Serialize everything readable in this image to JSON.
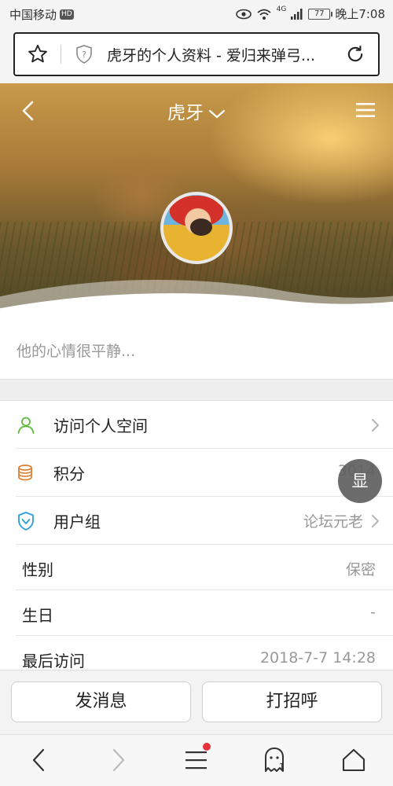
{
  "status_bar": {
    "carrier": "中国移动",
    "hd_badge": "HD",
    "network": "4G",
    "battery": "77",
    "time": "晚上7:08"
  },
  "browser": {
    "url_title": "虎牙的个人资料 - 爱归来弹弓..."
  },
  "profile": {
    "username": "虎牙",
    "mood": "他的心情很平静..."
  },
  "rows": [
    {
      "label": "访问个人空间",
      "value": "",
      "icon": "person-icon",
      "icon_color": "#5cbb3c"
    },
    {
      "label": "积分",
      "value": "3014",
      "icon": "coins-icon",
      "icon_color": "#e07a2c"
    },
    {
      "label": "用户组",
      "value": "论坛元老",
      "icon": "shield-check-icon",
      "icon_color": "#2a9fd6"
    },
    {
      "label": "性别",
      "value": "保密"
    },
    {
      "label": "生日",
      "value": "-"
    },
    {
      "label": "最后访问",
      "value": "2018-7-7 14:28"
    }
  ],
  "floating_button": "显",
  "actions": {
    "message": "发消息",
    "greet": "打招呼"
  },
  "bottom_nav": {
    "tabs_count": "1"
  },
  "colors": {
    "notification_dot": "#e8313a"
  }
}
